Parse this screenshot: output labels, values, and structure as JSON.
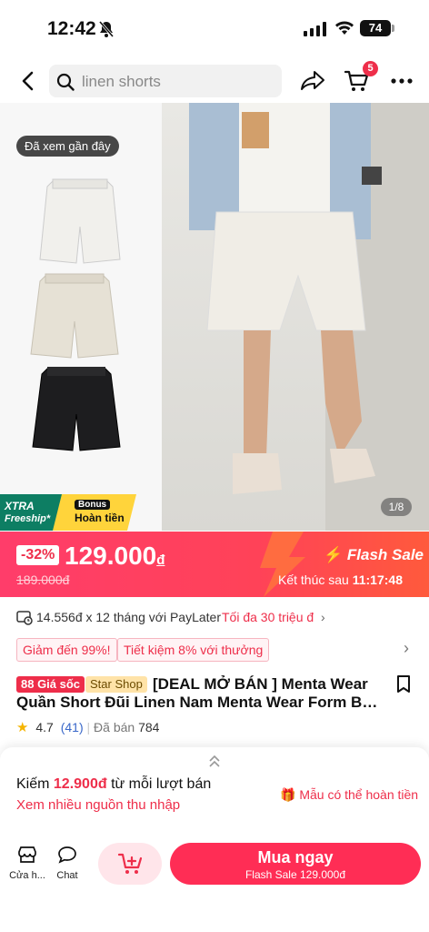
{
  "status_bar": {
    "time": "12:42",
    "battery": "74"
  },
  "header": {
    "search_text": "linen shorts",
    "cart_count": "5"
  },
  "gallery": {
    "recent_label": "Đã xem gần đây",
    "pager": "1/8"
  },
  "badges": {
    "xtra": "XTRA",
    "freeship": "Freeship*",
    "bonus": "Bonus",
    "cashback": "Hoàn tiền"
  },
  "flash": {
    "discount": "-32%",
    "price": "129.000",
    "currency": "đ",
    "old_price": "189.000đ",
    "title": "Flash Sale",
    "ends_label": "Kết thúc sau",
    "countdown": "11:17:48"
  },
  "paylater": {
    "text": "14.556đ x 12 tháng với PayLater",
    "limit": "Tối đa 30 triệu đ"
  },
  "vouchers": [
    "Giảm đến 99%!",
    "Tiết kiệm 8% với thưởng"
  ],
  "product": {
    "tag_sale": "88 Giá sốc",
    "tag_shop": "Star Shop",
    "title_line1": "[DEAL MỞ BÁN ] Menta Wear",
    "title_line2": "Quần Short Đũi Linen Nam Menta Wear Form Basic",
    "rating": "4.7",
    "reviews": "(41)",
    "sold_label": "Đã bán",
    "sold": "784"
  },
  "earn": {
    "prefix": "Kiếm",
    "amount": "12.900đ",
    "suffix": "từ mỗi lượt bán",
    "link": "Xem nhiều nguồn thu nhập",
    "sample": "Mẫu có thể hoàn tiền"
  },
  "actions": {
    "shop": "Cửa h...",
    "chat": "Chat",
    "buy": "Mua ngay",
    "buy_sub": "Flash Sale 129.000đ"
  },
  "colors": {
    "accent": "#ee2e4a",
    "flash_bg": "#ff3d6a",
    "xtra_green": "#0d7e63",
    "bonus_yellow": "#ffd43b"
  }
}
